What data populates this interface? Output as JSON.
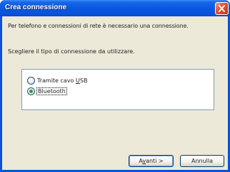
{
  "window": {
    "title": "Crea connessione"
  },
  "content": {
    "description": "Per telefono e connessioni di rete è necessario una connessione.",
    "prompt": "Scegliere il tipo di connessione da utilizzare."
  },
  "options": [
    {
      "label_pre": "Tramite cavo ",
      "label_accel": "U",
      "label_post": "SB",
      "selected": false
    },
    {
      "label": "Bluetooth",
      "selected": true
    }
  ],
  "buttons": {
    "next_pre": "A",
    "next_accel": "v",
    "next_post": "anti >",
    "cancel": "Annulla"
  },
  "icons": {
    "close": "close-icon"
  },
  "colors": {
    "titlebar": "#0a58e0",
    "client": "#ece9d8",
    "close": "#e2542b",
    "radio_dot": "#21a121"
  }
}
